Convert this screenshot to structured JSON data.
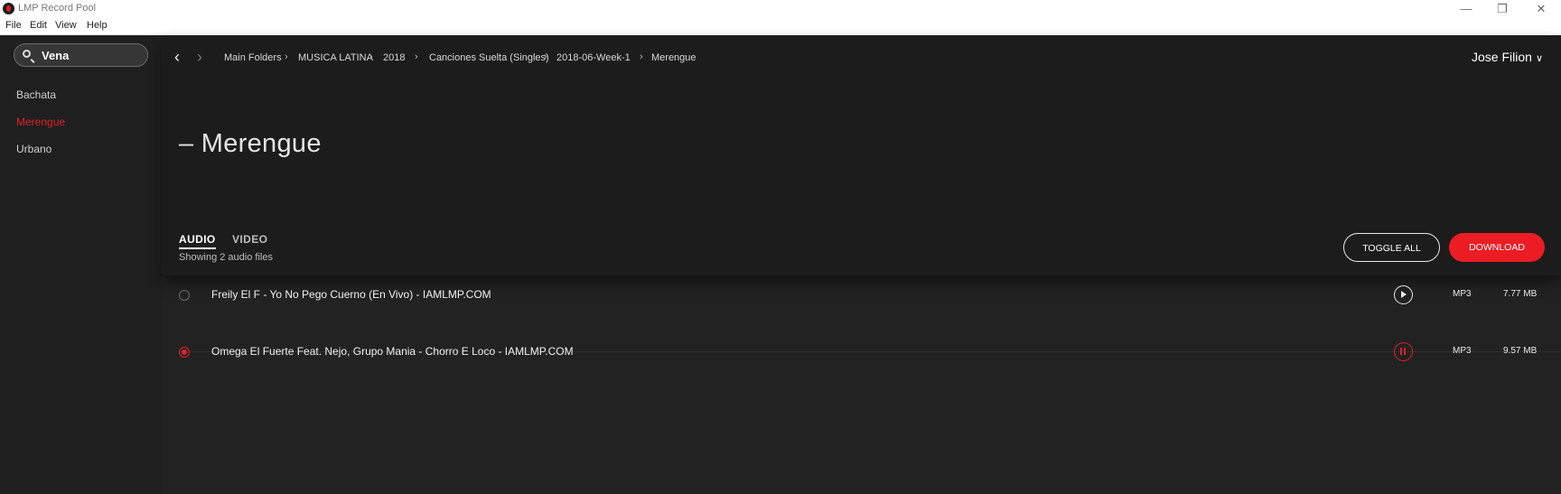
{
  "window": {
    "title": "LMP Record Pool",
    "controls": [
      "minimize-icon",
      "restore-icon",
      "close-icon"
    ]
  },
  "menu": {
    "items": [
      "File",
      "Edit",
      "View",
      "Help"
    ]
  },
  "sidebar": {
    "search": {
      "value": "Vena",
      "icon": "search-icon"
    },
    "items": [
      {
        "label": "Bachata",
        "active": false
      },
      {
        "label": "Merengue",
        "active": true
      },
      {
        "label": "Urbano",
        "active": false
      }
    ]
  },
  "breadcrumb": [
    "Main Folders",
    "MUSICA LATINA",
    "2018",
    "Canciones Suelta (Singles)",
    "2018-06-Week-1",
    "Merengue"
  ],
  "user": {
    "name": "Jose Filion"
  },
  "page": {
    "title": "– Merengue",
    "tabs": [
      {
        "label": "AUDIO",
        "active": true
      },
      {
        "label": "VIDEO",
        "active": false
      }
    ],
    "count_text": "Showing 2 audio files"
  },
  "actions": {
    "toggle_all": "TOGGLE ALL",
    "download": "DOWNLOAD"
  },
  "tracks": [
    {
      "name": "Freily El F - Yo No Pego Cuerno (En Vivo) - IAMLMP.COM",
      "format": "MP3",
      "size": "7.77 MB",
      "selected": false,
      "state": "stopped"
    },
    {
      "name": "Omega El Fuerte Feat. Nejo, Grupo Mania - Chorro E Loco - IAMLMP.COM",
      "format": "MP3",
      "size": "9.57 MB",
      "selected": true,
      "state": "playing"
    }
  ],
  "colors": {
    "accent": "#e02027",
    "download_button": "#ec1c24",
    "background": "#222222",
    "sidebar": "#1f1f1f"
  }
}
